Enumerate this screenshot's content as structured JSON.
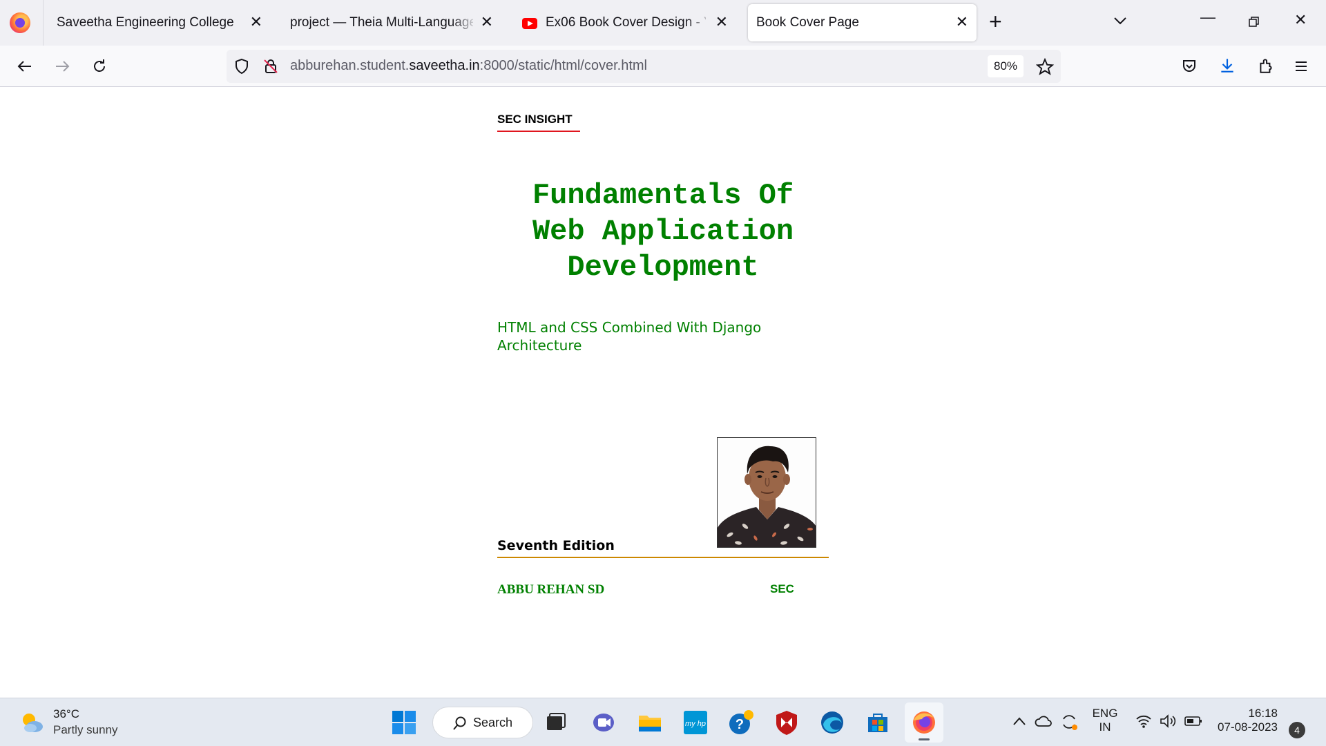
{
  "browser": {
    "tabs": [
      {
        "title": "Saveetha Engineering College",
        "active": false
      },
      {
        "title": "project — Theia Multi-Language Ex",
        "active": false
      },
      {
        "title": "Ex06 Book Cover Design - YouTu",
        "active": false
      },
      {
        "title": "Book Cover Page",
        "active": true
      }
    ],
    "url": {
      "prefix": "abburehan.student.",
      "host": "saveetha.in",
      "suffix": ":8000/static/html/cover.html"
    },
    "zoom": "80%"
  },
  "page": {
    "brand": "SEC INSIGHT",
    "title_lines": [
      "Fundamentals Of",
      "Web Application",
      "Development"
    ],
    "subtitle": "HTML and CSS Combined With Django Architecture",
    "edition": "Seventh Edition",
    "author": "ABBU REHAN SD",
    "publisher": "SEC",
    "colors": {
      "title": "#008000",
      "brand_rule": "#e0161e",
      "edition_rule": "#cc8800"
    }
  },
  "taskbar": {
    "weather": {
      "temp": "36°C",
      "condition": "Partly sunny"
    },
    "search_label": "Search",
    "language": {
      "line1": "ENG",
      "line2": "IN"
    },
    "time": "16:18",
    "date": "07-08-2023",
    "notification_count": "4"
  }
}
